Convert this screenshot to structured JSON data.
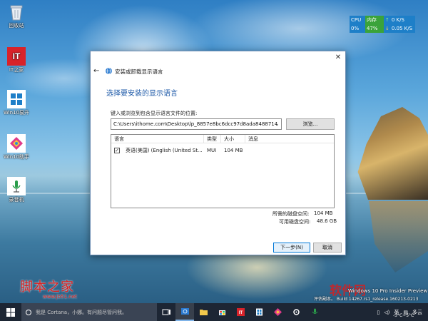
{
  "desktop": {
    "icons": [
      {
        "label": "回收站",
        "icon": "recycle-bin-icon"
      },
      {
        "label": "IT之家",
        "icon": "ithome-logo-icon",
        "badge": "IT"
      },
      {
        "label": "Win10易升",
        "icon": "windows-app-icon"
      },
      {
        "label": "Win10助手",
        "icon": "assistant-app-icon"
      },
      {
        "label": "录音机",
        "icon": "recorder-app-icon"
      }
    ]
  },
  "net_meter": {
    "cpu_label": "CPU",
    "mem_label": "内存",
    "cpu_value": "0%",
    "mem_value": "47%",
    "up_speed": "0 K/S",
    "down_speed": "0.05 K/S"
  },
  "dialog": {
    "window_title": "安装或卸载显示语言",
    "heading": "选择要安装的显示语言",
    "path_label": "键入或浏览到包含显示语言文件的位置:",
    "path_value": "C:\\Users\\ithome.com\\Desktop\\lp_8857e8bc6dcc97d8ada8488714",
    "browse_label": "浏览...",
    "table": {
      "columns": [
        "语言",
        "类型",
        "大小",
        "消息"
      ],
      "rows": [
        {
          "checked": true,
          "language": "英语(美国) (English (United St...",
          "type": "MUI",
          "size": "104 MB",
          "message": ""
        }
      ]
    },
    "space_needed_label": "所需的磁盘空间:",
    "space_needed_value": "104 MB",
    "space_available_label": "可用磁盘空间:",
    "space_available_value": "48.6 GB",
    "next_label": "下一步(N)",
    "cancel_label": "取消"
  },
  "watermark": {
    "left": "脚本之家",
    "url": "www.jb51.net",
    "right": "软件网"
  },
  "build_info": {
    "line1": "Windows 10 Pro Insider Preview",
    "line2": "评估副本。 Build 14267.rs1_release.160213-0213"
  },
  "taskbar": {
    "search_placeholder": "我是 Cortana，小娜。有问题尽管问我。",
    "ime_label": "英",
    "weather": "-3°C~5°C",
    "day_label": "多云"
  },
  "colors": {
    "accent": "#0078d7",
    "heading_blue": "#1e5aa8",
    "taskbar": "#1d2634",
    "watermark_red": "#d81e1e"
  }
}
